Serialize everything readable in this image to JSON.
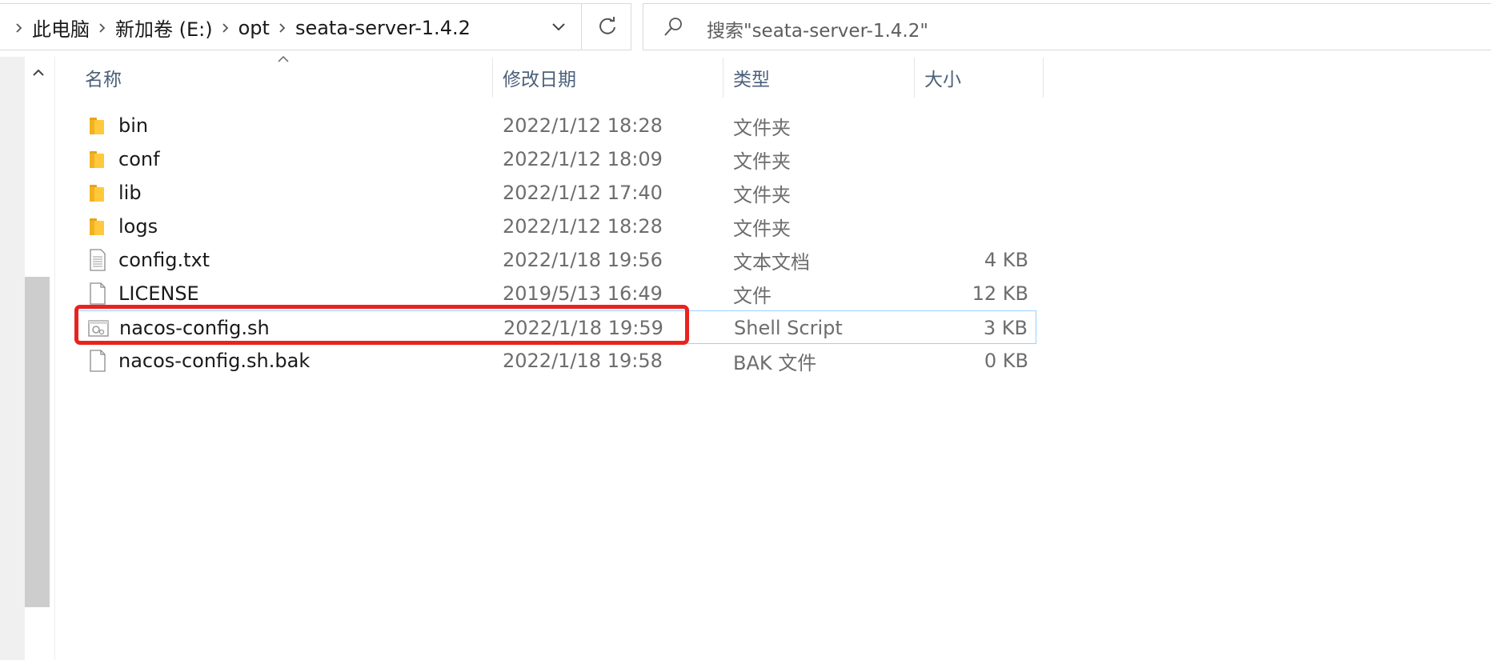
{
  "breadcrumb": [
    "此电脑",
    "新加卷 (E:)",
    "opt",
    "seata-server-1.4.2"
  ],
  "search": {
    "placeholder": "搜索\"seata-server-1.4.2\""
  },
  "columns": {
    "name": "名称",
    "date": "修改日期",
    "type": "类型",
    "size": "大小"
  },
  "files": [
    {
      "name": "bin",
      "date": "2022/1/12 18:28",
      "type": "文件夹",
      "size": "",
      "icon": "folder-icon"
    },
    {
      "name": "conf",
      "date": "2022/1/12 18:09",
      "type": "文件夹",
      "size": "",
      "icon": "folder-icon"
    },
    {
      "name": "lib",
      "date": "2022/1/12 17:40",
      "type": "文件夹",
      "size": "",
      "icon": "folder-icon"
    },
    {
      "name": "logs",
      "date": "2022/1/12 18:28",
      "type": "文件夹",
      "size": "",
      "icon": "folder-icon"
    },
    {
      "name": "config.txt",
      "date": "2022/1/18 19:56",
      "type": "文本文档",
      "size": "4 KB",
      "icon": "text-file-icon"
    },
    {
      "name": "LICENSE",
      "date": "2019/5/13 16:49",
      "type": "文件",
      "size": "12 KB",
      "icon": "file-icon"
    },
    {
      "name": "nacos-config.sh",
      "date": "2022/1/18 19:59",
      "type": "Shell Script",
      "size": "3 KB",
      "icon": "script-file-icon",
      "selected": true,
      "highlighted": true
    },
    {
      "name": "nacos-config.sh.bak",
      "date": "2022/1/18 19:58",
      "type": "BAK 文件",
      "size": "0 KB",
      "icon": "file-icon"
    }
  ],
  "colors": {
    "highlight": "#e8231f",
    "selection_border": "#99d1ff",
    "folder": "#ffc83d",
    "header_text": "#4c607a"
  }
}
